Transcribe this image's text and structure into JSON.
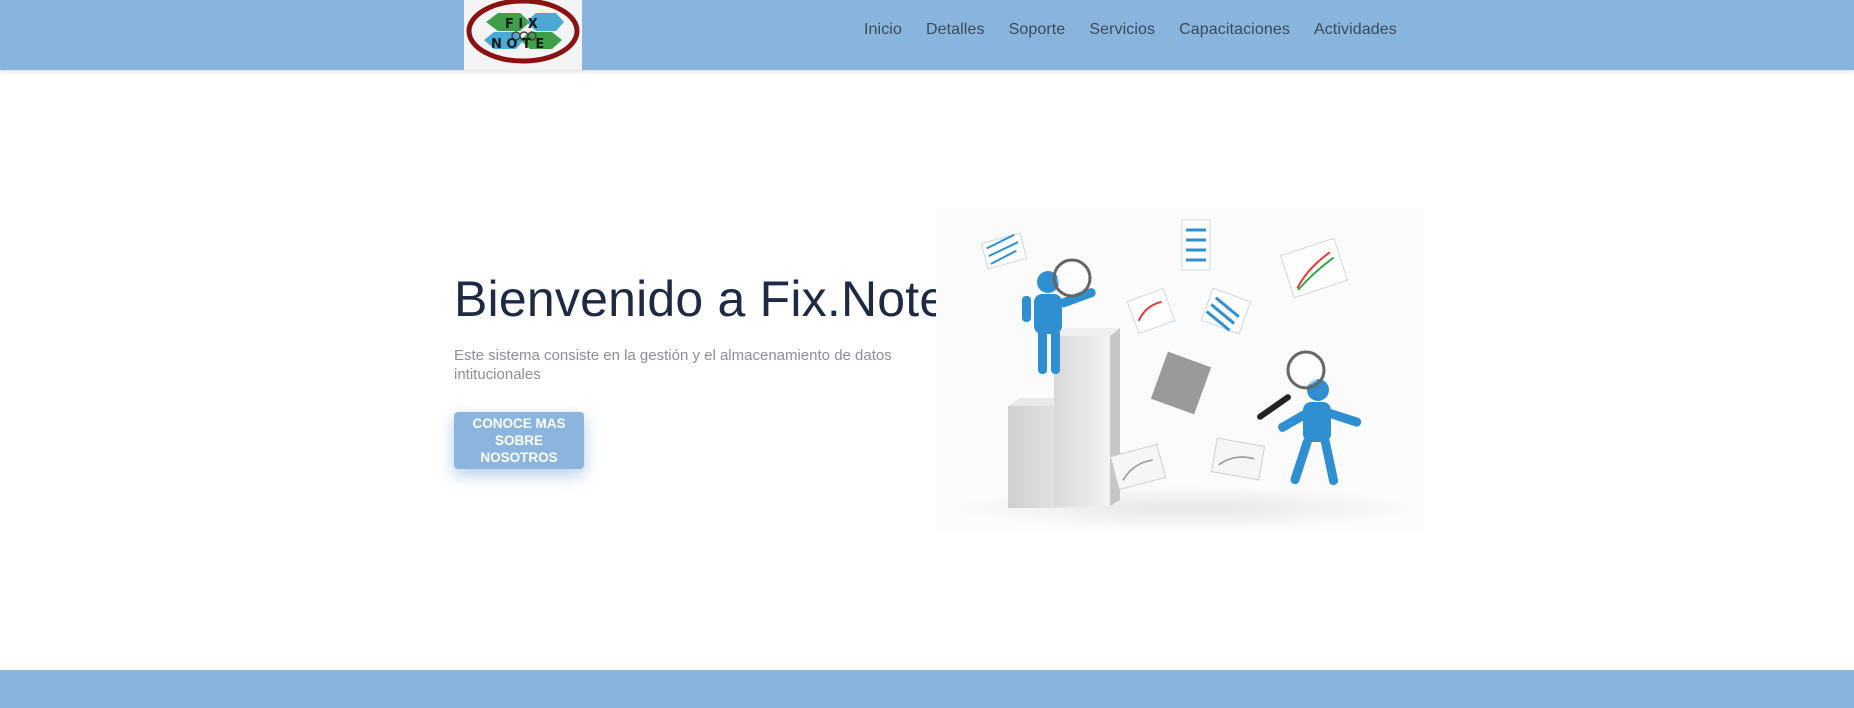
{
  "brand": {
    "logo_letters_top": "F I X",
    "logo_letters_bottom": "N O T E"
  },
  "nav": {
    "items": [
      {
        "label": "Inicio"
      },
      {
        "label": "Detalles"
      },
      {
        "label": "Soporte"
      },
      {
        "label": "Servicios"
      },
      {
        "label": "Capacitaciones"
      },
      {
        "label": "Actividades"
      }
    ]
  },
  "hero": {
    "title": "Bienvenido a Fix.Note",
    "description": "Este sistema consiste en la gestión y el almacenamiento de datos intitucionales",
    "cta_label": "CONOCE MAS SOBRE NOSOTROS"
  },
  "colors": {
    "navbar": "#89b4de",
    "button": "#8cb5de",
    "title": "#1e2a44",
    "figure_blue": "#2f8fd0"
  },
  "icons": {
    "illustration": "analysis-illustration-icon"
  }
}
